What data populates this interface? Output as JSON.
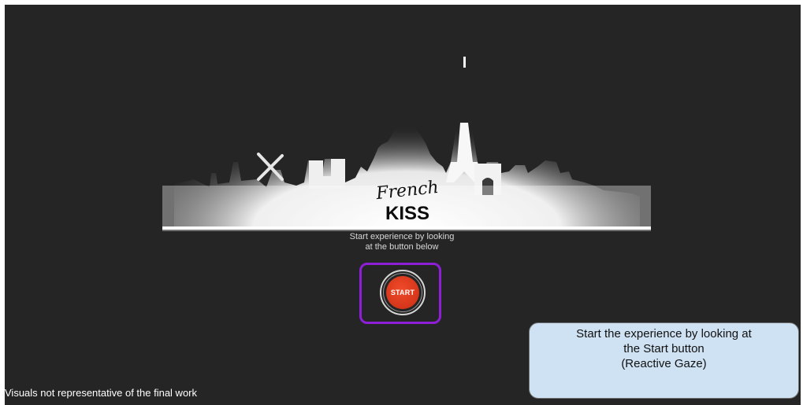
{
  "logo": {
    "script": "French",
    "word": "KISS"
  },
  "instruction": "Start experience by looking\nat the button below",
  "start_button": {
    "label": "START",
    "color": "#e03a1c",
    "highlight_color": "#8e1fd6"
  },
  "callout": {
    "line1": "Start the experience by looking at",
    "line2": "the Start button",
    "line3": "(Reactive Gaze)"
  },
  "disclaimer": "Visuals not representative of the final work",
  "colors": {
    "background": "#252525",
    "callout_bg": "#cfe2f3"
  }
}
